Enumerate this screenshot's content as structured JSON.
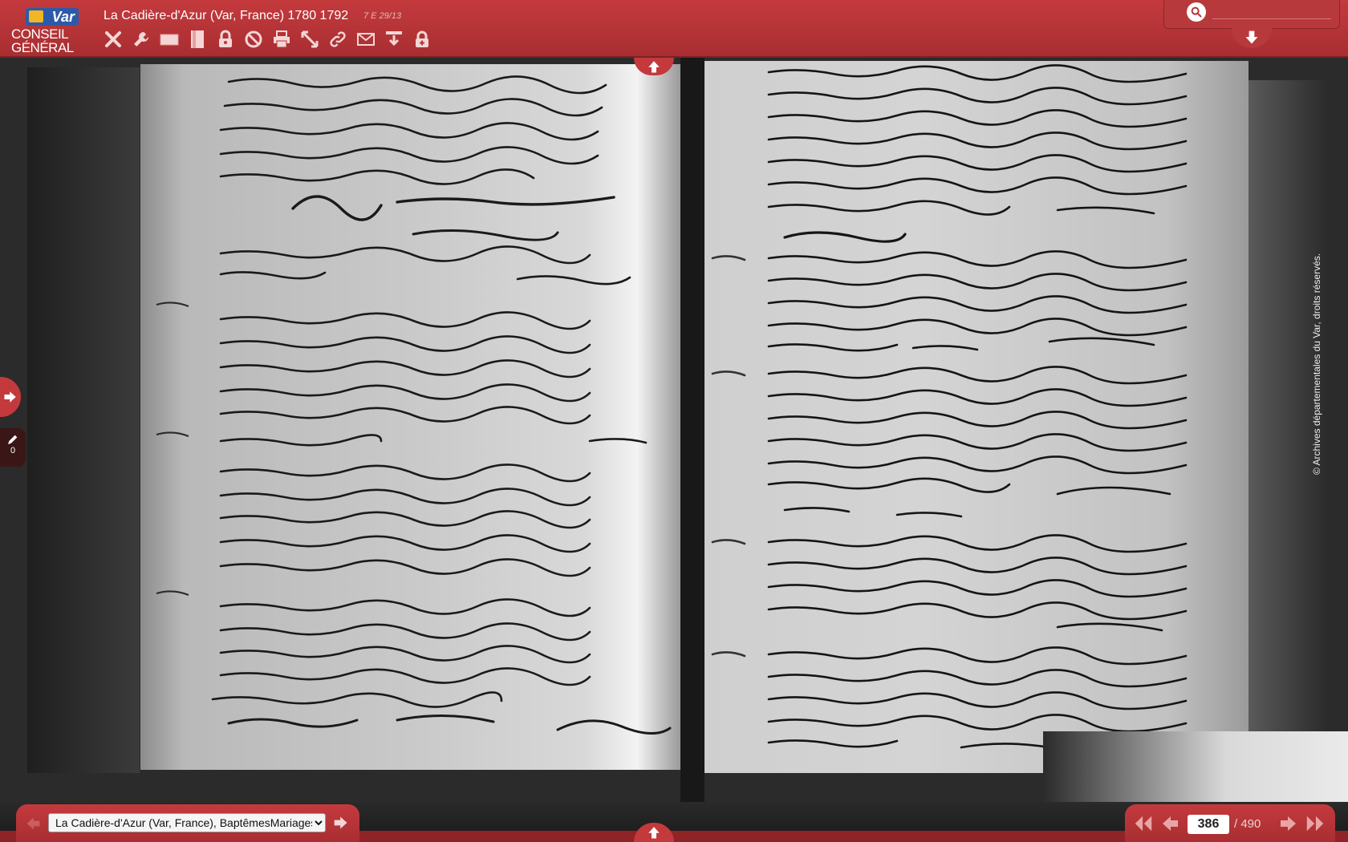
{
  "header": {
    "logo_var": "Var",
    "logo_line1": "CONSEIL",
    "logo_line2": "GÉNÉRAL",
    "title": "La Cadière-d'Azur (Var, France) 1780 1792",
    "cote": "7 E 29/13"
  },
  "toolbar": {
    "icons": [
      "close-icon",
      "wrench-icon",
      "fit-width-icon",
      "fit-page-icon",
      "lock-icon",
      "block-icon",
      "print-icon",
      "expand-icon",
      "link-icon",
      "mail-icon",
      "download-icon",
      "unlock-icon"
    ]
  },
  "search": {
    "value": ""
  },
  "side": {
    "annotation_count": "0"
  },
  "scan": {
    "copyright": "© Archives départementales du Var, droits réservés."
  },
  "bottom": {
    "document_selected": "La Cadière-d'Azur (Var, France), BaptêmesMariages",
    "current_page": "386",
    "total_pages": "/ 490"
  },
  "colors": {
    "accent": "#c43a3d",
    "accent_dark": "#a82e31"
  }
}
